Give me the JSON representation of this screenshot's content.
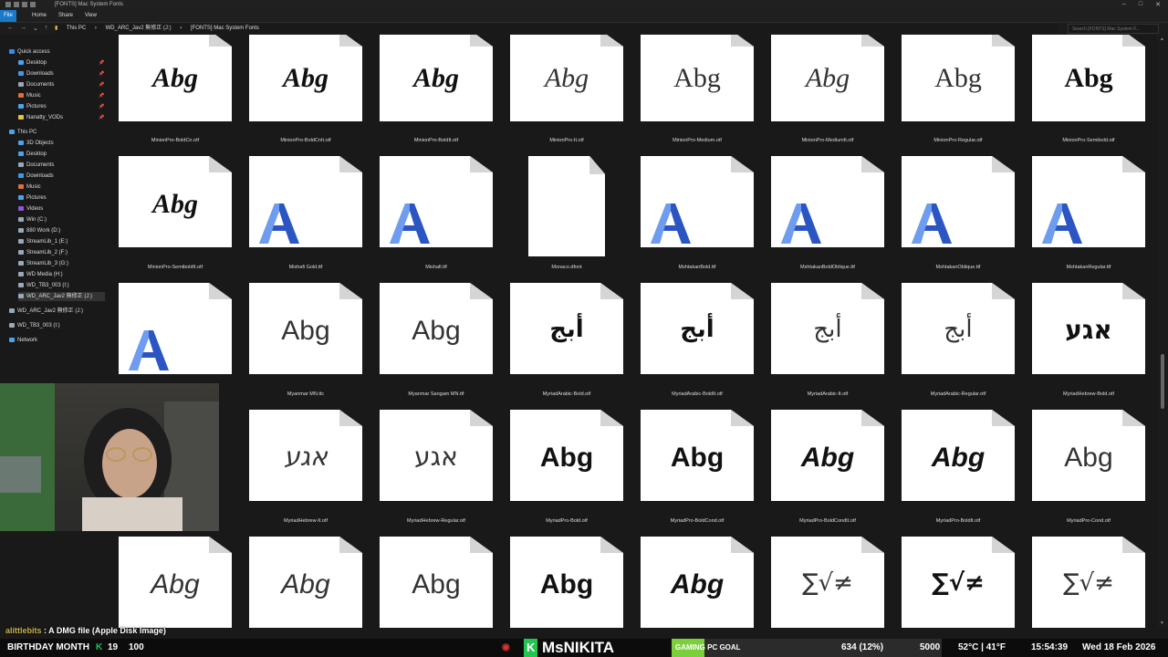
{
  "window": {
    "title": "[FONTS] Mac System Fonts"
  },
  "ribbon": {
    "tabs": [
      "File",
      "Home",
      "Share",
      "View"
    ]
  },
  "address": {
    "path": [
      "This PC",
      "WD_ARC_Jav2 無修正 (J:)",
      "[FONTS] Mac System Fonts"
    ],
    "search_placeholder": "Search [FONTS] Mac System F..."
  },
  "sidebar": {
    "items": [
      {
        "label": "Quick access",
        "icon": "star-icon",
        "color": "#2f8cf0",
        "indent": 0,
        "pinned": false
      },
      {
        "label": "Desktop",
        "icon": "desktop-icon",
        "color": "#4aa3f0",
        "indent": 1,
        "pinned": true
      },
      {
        "label": "Downloads",
        "icon": "download-icon",
        "color": "#3d9be9",
        "indent": 1,
        "pinned": true
      },
      {
        "label": "Documents",
        "icon": "document-icon",
        "color": "#9aa8b8",
        "indent": 1,
        "pinned": true
      },
      {
        "label": "Music",
        "icon": "music-icon",
        "color": "#e0703a",
        "indent": 1,
        "pinned": true
      },
      {
        "label": "Pictures",
        "icon": "pictures-icon",
        "color": "#4aa3f0",
        "indent": 1,
        "pinned": true
      },
      {
        "label": "Nanatty_VODs",
        "icon": "folder-icon",
        "color": "#e8c04a",
        "indent": 1,
        "pinned": true
      },
      {
        "label": "This PC",
        "icon": "pc-icon",
        "color": "#4aa3f0",
        "indent": 0,
        "pinned": false
      },
      {
        "label": "3D Objects",
        "icon": "cube-icon",
        "color": "#4aa3f0",
        "indent": 1,
        "pinned": false
      },
      {
        "label": "Desktop",
        "icon": "desktop-icon",
        "color": "#4aa3f0",
        "indent": 1,
        "pinned": false
      },
      {
        "label": "Documents",
        "icon": "document-icon",
        "color": "#9aa8b8",
        "indent": 1,
        "pinned": false
      },
      {
        "label": "Downloads",
        "icon": "download-icon",
        "color": "#3d9be9",
        "indent": 1,
        "pinned": false
      },
      {
        "label": "Music",
        "icon": "music-icon",
        "color": "#e0703a",
        "indent": 1,
        "pinned": false
      },
      {
        "label": "Pictures",
        "icon": "pictures-icon",
        "color": "#4aa3f0",
        "indent": 1,
        "pinned": false
      },
      {
        "label": "Videos",
        "icon": "video-icon",
        "color": "#8c5ad6",
        "indent": 1,
        "pinned": false
      },
      {
        "label": "Win (C:)",
        "icon": "drive-icon",
        "color": "#9aa8b8",
        "indent": 1,
        "pinned": false
      },
      {
        "label": "880 Work (D:)",
        "icon": "drive-icon",
        "color": "#9aa8b8",
        "indent": 1,
        "pinned": false
      },
      {
        "label": "StreamLib_1 (E:)",
        "icon": "drive-icon",
        "color": "#9aa8b8",
        "indent": 1,
        "pinned": false
      },
      {
        "label": "StreamLib_2 (F:)",
        "icon": "drive-icon",
        "color": "#9aa8b8",
        "indent": 1,
        "pinned": false
      },
      {
        "label": "StreamLib_3 (G:)",
        "icon": "drive-icon",
        "color": "#9aa8b8",
        "indent": 1,
        "pinned": false
      },
      {
        "label": "WD Media (H:)",
        "icon": "drive-icon",
        "color": "#9aa8b8",
        "indent": 1,
        "pinned": false
      },
      {
        "label": "WD_TB3_003 (I:)",
        "icon": "drive-icon",
        "color": "#9aa8b8",
        "indent": 1,
        "pinned": false
      },
      {
        "label": "WD_ARC_Jav2 無修正 (J:)",
        "icon": "drive-icon",
        "color": "#9aa8b8",
        "indent": 1,
        "pinned": false,
        "selected": true
      },
      {
        "label": "WD_ARC_Jav2 無修正 (J:)",
        "icon": "drive-icon",
        "color": "#9aa8b8",
        "indent": 0,
        "pinned": false
      },
      {
        "label": "WD_TB3_003 (I:)",
        "icon": "drive-icon",
        "color": "#9aa8b8",
        "indent": 0,
        "pinned": false
      },
      {
        "label": "Network",
        "icon": "network-icon",
        "color": "#4aa3f0",
        "indent": 0,
        "pinned": false
      }
    ]
  },
  "files": [
    {
      "row": 0,
      "col": 0,
      "name": "MinionPro-BoldCn.otf",
      "preview": "Abg",
      "style": "serif bold ital"
    },
    {
      "row": 0,
      "col": 1,
      "name": "MinionPro-BoldCnIt.otf",
      "preview": "Abg",
      "style": "serif bold ital"
    },
    {
      "row": 0,
      "col": 2,
      "name": "MinionPro-BoldIt.otf",
      "preview": "Abg",
      "style": "serif bold ital"
    },
    {
      "row": 0,
      "col": 3,
      "name": "MinionPro-It.otf",
      "preview": "Abg",
      "style": "serif ital light"
    },
    {
      "row": 0,
      "col": 4,
      "name": "MinionPro-Medium.otf",
      "preview": "Abg",
      "style": "serif light"
    },
    {
      "row": 0,
      "col": 5,
      "name": "MinionPro-MediumIt.otf",
      "preview": "Abg",
      "style": "serif ital light"
    },
    {
      "row": 0,
      "col": 6,
      "name": "MinionPro-Regular.otf",
      "preview": "Abg",
      "style": "serif light"
    },
    {
      "row": 0,
      "col": 7,
      "name": "MinionPro-Semibold.otf",
      "preview": "Abg",
      "style": "serif bold"
    },
    {
      "row": 1,
      "col": 0,
      "name": "MinionPro-SemiboldIt.otf",
      "preview": "Abg",
      "style": "serif bold ital"
    },
    {
      "row": 1,
      "col": 1,
      "name": "Mishafi Gold.ttf",
      "preview": "",
      "style": "font-a"
    },
    {
      "row": 1,
      "col": 2,
      "name": "Mishafi.ttf",
      "preview": "",
      "style": "font-a"
    },
    {
      "row": 1,
      "col": 3,
      "name": "Monaco.dfont",
      "preview": "",
      "style": "blank"
    },
    {
      "row": 1,
      "col": 4,
      "name": "MshtakanBold.ttf",
      "preview": "",
      "style": "font-a"
    },
    {
      "row": 1,
      "col": 5,
      "name": "MshtakanBoldOblique.ttf",
      "preview": "",
      "style": "font-a"
    },
    {
      "row": 1,
      "col": 6,
      "name": "MshtakanOblique.ttf",
      "preview": "",
      "style": "font-a"
    },
    {
      "row": 1,
      "col": 7,
      "name": "MshtakanRegular.ttf",
      "preview": "",
      "style": "font-a"
    },
    {
      "row": 2,
      "col": 0,
      "name": "",
      "preview": "",
      "style": "font-a"
    },
    {
      "row": 2,
      "col": 1,
      "name": "Myanmar MN.ttc",
      "preview": "Abg",
      "style": "sans light"
    },
    {
      "row": 2,
      "col": 2,
      "name": "Myanmar Sangam MN.ttf",
      "preview": "Abg",
      "style": "sans light"
    },
    {
      "row": 2,
      "col": 3,
      "name": "MyriadArabic-Bold.otf",
      "preview": "أبج",
      "style": "arab bold"
    },
    {
      "row": 2,
      "col": 4,
      "name": "MyriadArabic-BoldIt.otf",
      "preview": "أبج",
      "style": "arab bold"
    },
    {
      "row": 2,
      "col": 5,
      "name": "MyriadArabic-It.otf",
      "preview": "أبج",
      "style": "arab light"
    },
    {
      "row": 2,
      "col": 6,
      "name": "MyriadArabic-Regular.otf",
      "preview": "أبج",
      "style": "arab light"
    },
    {
      "row": 2,
      "col": 7,
      "name": "MyriadHebrew-Bold.otf",
      "preview": "אגע",
      "style": "hebr bold"
    },
    {
      "row": 3,
      "col": 1,
      "name": "MyriadHebrew-It.otf",
      "preview": "אגע",
      "style": "hebr ital light"
    },
    {
      "row": 3,
      "col": 2,
      "name": "MyriadHebrew-Regular.otf",
      "preview": "אגע",
      "style": "hebr light"
    },
    {
      "row": 3,
      "col": 3,
      "name": "MyriadPro-Bold.otf",
      "preview": "Abg",
      "style": "sans bold"
    },
    {
      "row": 3,
      "col": 4,
      "name": "MyriadPro-BoldCond.otf",
      "preview": "Abg",
      "style": "sans bold"
    },
    {
      "row": 3,
      "col": 5,
      "name": "MyriadPro-BoldCondIt.otf",
      "preview": "Abg",
      "style": "sans bold ital"
    },
    {
      "row": 3,
      "col": 6,
      "name": "MyriadPro-BoldIt.otf",
      "preview": "Abg",
      "style": "sans bold ital"
    },
    {
      "row": 3,
      "col": 7,
      "name": "MyriadPro-Cond.otf",
      "preview": "Abg",
      "style": "sans light"
    },
    {
      "row": 4,
      "col": 0,
      "name": "",
      "preview": "Abg",
      "style": "sans ital light"
    },
    {
      "row": 4,
      "col": 1,
      "name": "",
      "preview": "Abg",
      "style": "sans ital light"
    },
    {
      "row": 4,
      "col": 2,
      "name": "",
      "preview": "Abg",
      "style": "sans light"
    },
    {
      "row": 4,
      "col": 3,
      "name": "",
      "preview": "Abg",
      "style": "sans bold"
    },
    {
      "row": 4,
      "col": 4,
      "name": "",
      "preview": "Abg",
      "style": "sans bold ital"
    },
    {
      "row": 4,
      "col": 5,
      "name": "",
      "preview": "∑√≠",
      "style": "math light"
    },
    {
      "row": 4,
      "col": 6,
      "name": "",
      "preview": "∑√≠",
      "style": "math bold"
    },
    {
      "row": 4,
      "col": 7,
      "name": "",
      "preview": "∑√≠",
      "style": "math light"
    }
  ],
  "chat": {
    "user": "alittlebits",
    "message": " : A DMG file (Apple Disk Image)"
  },
  "overlay": {
    "left": "BIRTHDAY MONTH",
    "left_count": "19",
    "left_pct": "100",
    "brand_k": "K",
    "brand": "MsNIKITA",
    "goal_label": "GAMING PC GOAL",
    "goal_value": "634 (12%)",
    "goal_target": "5000",
    "weather": "52°C | 41°F",
    "time": "15:54:39",
    "date": "Wed 18 Feb 2026"
  },
  "colors": {
    "accent": "#1979ca",
    "goal_green": "#7ad03a",
    "brand_green": "#23c552"
  }
}
